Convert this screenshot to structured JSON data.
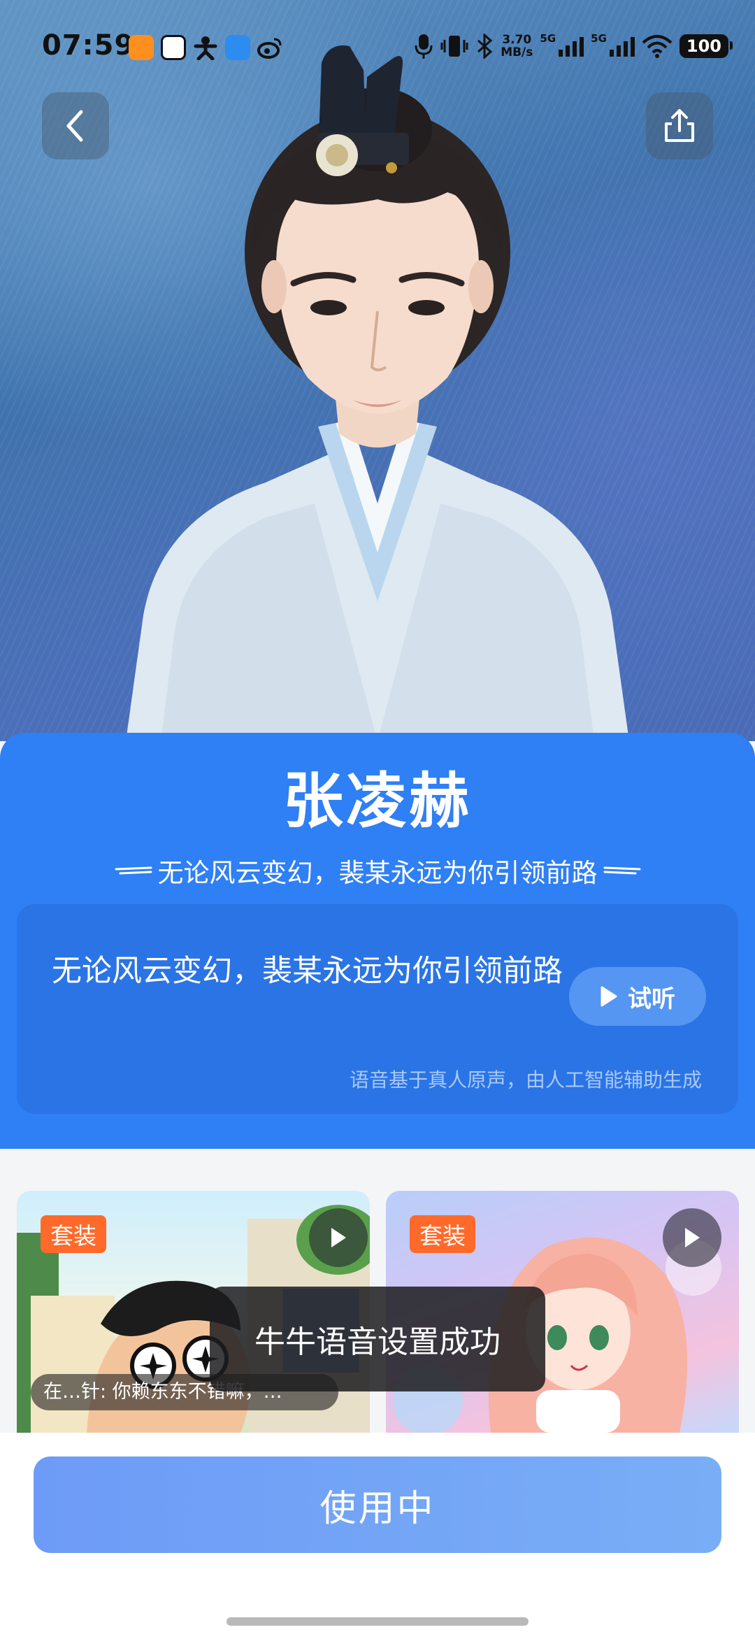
{
  "status_bar": {
    "time": "07:59",
    "net_speed_value": "3.70",
    "net_speed_unit": "MB/s",
    "sim1_label": "5G",
    "sim2_label": "5G",
    "battery": "100"
  },
  "header": {
    "back_icon": "chevron-left-icon",
    "share_icon": "share-icon"
  },
  "voice": {
    "name": "张凌赫",
    "tagline": "无论风云变幻，裴某永远为你引领前路",
    "sample_text": "无论风云变幻，裴某永远为你引领前路",
    "listen_label": "试听",
    "ai_note": "语音基于真人原声，由人工智能辅助生成"
  },
  "presets": [
    {
      "badge": "套装",
      "caption": "在…针: 你赖东东不错嘛，…"
    },
    {
      "badge": "套装",
      "caption": ""
    }
  ],
  "toast": {
    "message": "牛牛语音设置成功"
  },
  "action": {
    "use_label": "使用中"
  },
  "colors": {
    "primary_blue": "#2f7ff5",
    "card_blue": "#2a74e6",
    "badge_orange": "#ff6a2b",
    "button_gradient_start": "#6d9bf7",
    "button_gradient_end": "#79aef6"
  }
}
